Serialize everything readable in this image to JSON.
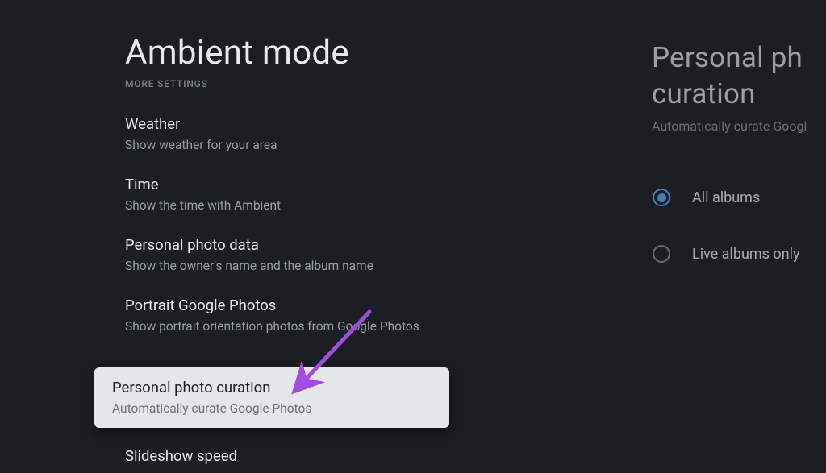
{
  "page_title": "Ambient mode",
  "section_label": "MORE SETTINGS",
  "settings": [
    {
      "title": "Weather",
      "desc": "Show weather for your area"
    },
    {
      "title": "Time",
      "desc": "Show the time with Ambient"
    },
    {
      "title": "Personal photo data",
      "desc": "Show the owner's name and the album name"
    },
    {
      "title": "Portrait Google Photos",
      "desc": "Show portrait orientation photos from Google Photos"
    }
  ],
  "highlighted": {
    "title": "Personal photo curation",
    "desc": "Automatically curate Google Photos"
  },
  "below_item": {
    "title": "Slideshow speed"
  },
  "right": {
    "title_line1": "Personal ph",
    "title_line2": "curation",
    "desc": "Automatically curate Googl",
    "options": [
      {
        "label": "All albums",
        "selected": true
      },
      {
        "label": "Live albums only",
        "selected": false
      }
    ]
  }
}
